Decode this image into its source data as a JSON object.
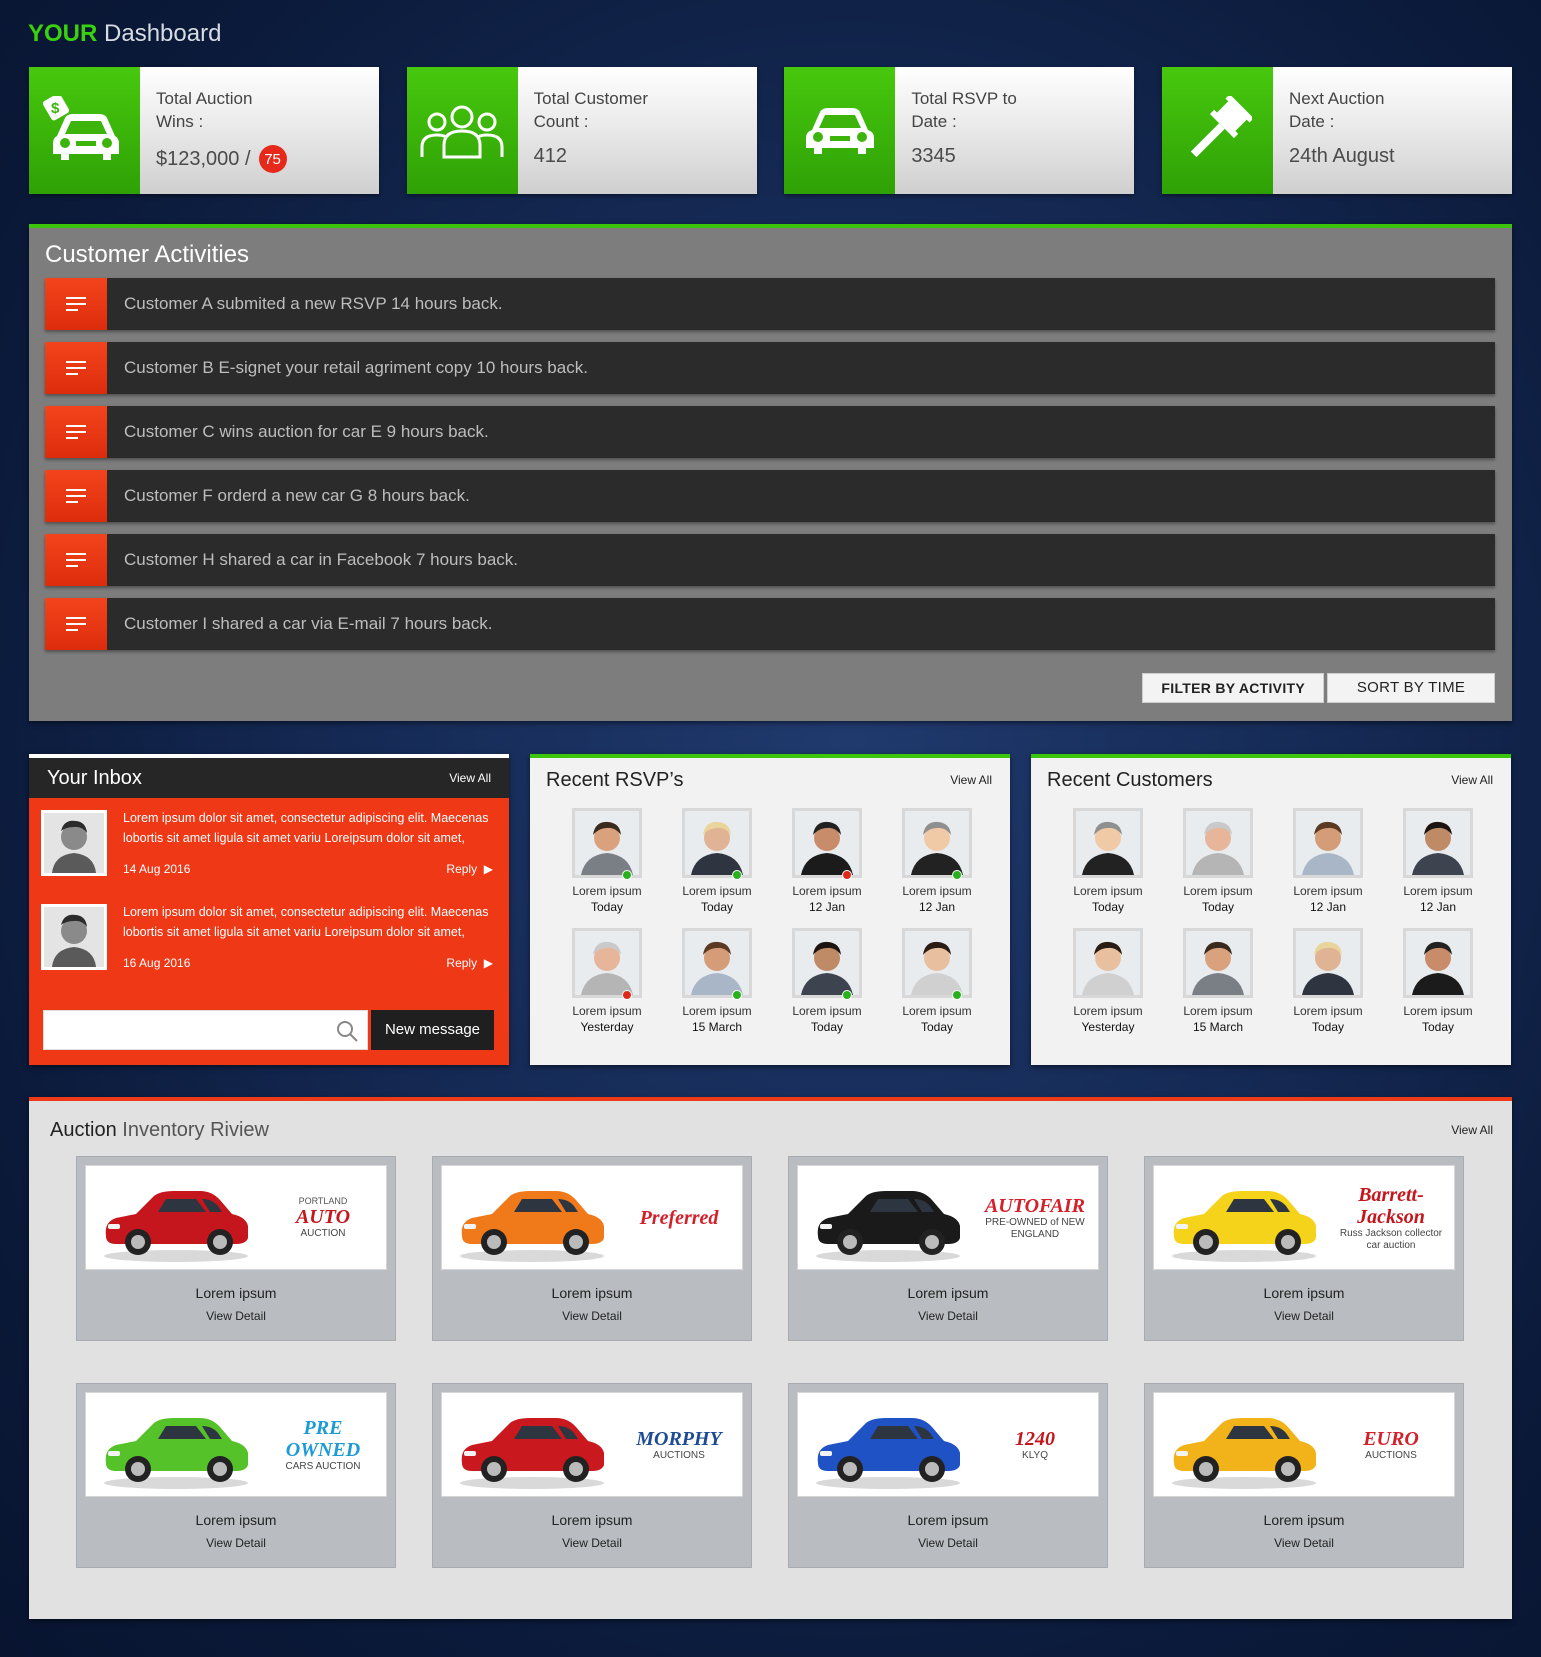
{
  "header": {
    "title_accent": "YOUR",
    "title_rest": "Dashboard"
  },
  "stats": [
    {
      "label_line1": "Total Auction",
      "label_line2": "Wins :",
      "value": "$123,000 /",
      "badge": "75",
      "icon": "car-money-icon"
    },
    {
      "label_line1": "Total Customer",
      "label_line2": "Count :",
      "value": "412",
      "badge": "",
      "icon": "users-icon"
    },
    {
      "label_line1": "Total RSVP to",
      "label_line2": "Date :",
      "value": "3345",
      "badge": "",
      "icon": "car-icon"
    },
    {
      "label_line1": "Next Auction",
      "label_line2": "Date :",
      "value": "24th August",
      "badge": "",
      "icon": "gavel-icon"
    }
  ],
  "activities": {
    "title": "Customer Activities",
    "items": [
      "Customer A submited a new RSVP 14 hours back.",
      "Customer B E-signet your retail agriment copy 10 hours back.",
      "Customer C wins auction  for car E 9 hours back.",
      "Customer F orderd a new car G 8 hours back.",
      "Customer H shared a car in Facebook 7 hours back.",
      "Customer I shared a car via E-mail 7 hours back."
    ],
    "filter_label": "FILTER BY ACTIVITY",
    "sort_label": "SORT BY TIME"
  },
  "inbox": {
    "title_strong": "Your",
    "title_rest": "Inbox",
    "view_all": "View All",
    "messages": [
      {
        "text": "Lorem ipsum dolor sit amet, consectetur adipiscing elit. Maecenas lobortis sit amet ligula sit amet variu Loreipsum dolor sit amet,",
        "date": "14 Aug 2016",
        "reply": "Reply"
      },
      {
        "text": "Lorem ipsum dolor sit amet, consectetur adipiscing elit. Maecenas lobortis sit amet ligula sit amet variu Loreipsum dolor sit amet,",
        "date": "16 Aug 2016",
        "reply": "Reply"
      }
    ],
    "search_placeholder": "",
    "new_message": "New message"
  },
  "rsvps": {
    "title_strong": "Recent",
    "title_rest": "RSVP’s",
    "view_all": "View All",
    "people": [
      {
        "name": "Lorem ipsum",
        "when": "Today",
        "status": "#27b11b"
      },
      {
        "name": "Lorem ipsum",
        "when": "Today",
        "status": "#27b11b"
      },
      {
        "name": "Lorem ipsum",
        "when": "12 Jan",
        "status": "#e0281a"
      },
      {
        "name": "Lorem ipsum",
        "when": "12 Jan",
        "status": "#27b11b"
      },
      {
        "name": "Lorem ipsum",
        "when": "Yesterday",
        "status": "#e0281a"
      },
      {
        "name": "Lorem ipsum",
        "when": "15 March",
        "status": "#27b11b"
      },
      {
        "name": "Lorem ipsum",
        "when": "Today",
        "status": "#27b11b"
      },
      {
        "name": "Lorem ipsum",
        "when": "Today",
        "status": "#27b11b"
      }
    ]
  },
  "customers": {
    "title_strong": "Recent",
    "title_rest": "Customers",
    "view_all": "View All",
    "people": [
      {
        "name": "Lorem ipsum",
        "when": "Today"
      },
      {
        "name": "Lorem ipsum",
        "when": "Today"
      },
      {
        "name": "Lorem ipsum",
        "when": "12 Jan"
      },
      {
        "name": "Lorem ipsum",
        "when": "12 Jan"
      },
      {
        "name": "Lorem ipsum",
        "when": "Yesterday"
      },
      {
        "name": "Lorem ipsum",
        "when": "15 March"
      },
      {
        "name": "Lorem ipsum",
        "when": "Today"
      },
      {
        "name": "Lorem ipsum",
        "when": "Today"
      }
    ]
  },
  "auction": {
    "title_strong": "Auction",
    "title_rest": "Inventory Riview",
    "view_all": "View All",
    "cars": [
      {
        "name": "Lorem ipsum",
        "detail": "View Detail",
        "car_color": "#c4161c",
        "logo_line1": "PORTLAND",
        "logo_line2": "AUTO",
        "logo_line3": "AUCTION",
        "logo_color": "#c4161c"
      },
      {
        "name": "Lorem ipsum",
        "detail": "View Detail",
        "car_color": "#f07a1a",
        "logo_line1": "",
        "logo_line2": "Preferred",
        "logo_line3": "",
        "logo_color": "#d3202b"
      },
      {
        "name": "Lorem ipsum",
        "detail": "View Detail",
        "car_color": "#1a1a1a",
        "logo_line1": "",
        "logo_line2": "AUTOFAIR",
        "logo_line3": "PRE-OWNED of NEW ENGLAND",
        "logo_color": "#d3202b"
      },
      {
        "name": "Lorem ipsum",
        "detail": "View Detail",
        "car_color": "#f5d31a",
        "logo_line1": "",
        "logo_line2": "Barrett-Jackson",
        "logo_line3": "Russ Jackson collector car auction",
        "logo_color": "#c4161c"
      },
      {
        "name": "Lorem ipsum",
        "detail": "View Detail",
        "car_color": "#56c22a",
        "logo_line1": "",
        "logo_line2": "PRE OWNED",
        "logo_line3": "CARS AUCTION",
        "logo_color": "#1e9ad6"
      },
      {
        "name": "Lorem ipsum",
        "detail": "View Detail",
        "car_color": "#c9181e",
        "logo_line1": "",
        "logo_line2": "MORPHY",
        "logo_line3": "AUCTIONS",
        "logo_color": "#1e4c94"
      },
      {
        "name": "Lorem ipsum",
        "detail": "View Detail",
        "car_color": "#1f52c4",
        "logo_line1": "",
        "logo_line2": "1240",
        "logo_line3": "KLYQ",
        "logo_color": "#c4161c"
      },
      {
        "name": "Lorem ipsum",
        "detail": "View Detail",
        "car_color": "#f2b31a",
        "logo_line1": "",
        "logo_line2": "EURO",
        "logo_line3": "AUCTIONS",
        "logo_color": "#d3202b"
      }
    ]
  }
}
